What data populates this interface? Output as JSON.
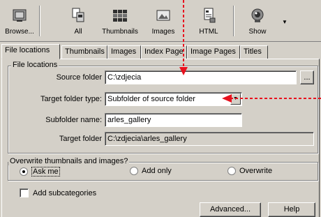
{
  "toolbar": {
    "buttons": [
      {
        "label": "Browse...",
        "icon": "browse-icon"
      },
      {
        "label": "All",
        "icon": "all-icon"
      },
      {
        "label": "Thumbnails",
        "icon": "thumbnails-icon"
      },
      {
        "label": "Images",
        "icon": "images-icon"
      },
      {
        "label": "HTML",
        "icon": "html-icon"
      },
      {
        "label": "Show",
        "icon": "show-icon"
      }
    ],
    "dropdown_icon": "dropdown-arrow-icon"
  },
  "tabs": [
    "File locations",
    "Thumbnails",
    "Images",
    "Index Page",
    "Image Pages",
    "Titles"
  ],
  "active_tab": "File locations",
  "file_locations": {
    "group_title": "File locations",
    "source_folder_label": "Source folder",
    "source_folder_value": "C:\\zdjecia",
    "browse_button": "...",
    "target_type_label": "Target folder type:",
    "target_type_value": "Subfolder of source folder",
    "subfolder_label": "Subfolder name:",
    "subfolder_value": "arles_gallery",
    "target_folder_label": "Target folder",
    "target_folder_value": "C:\\zdjecia\\arles_gallery"
  },
  "overwrite": {
    "group_title": "Overwrite thumbnails and images?",
    "options": [
      "Ask me",
      "Add only",
      "Overwrite"
    ],
    "selected": "Ask me"
  },
  "subcategories_label": "Add subcategories",
  "subcategories_checked": false,
  "buttons": {
    "advanced": "Advanced...",
    "help": "Help"
  },
  "annotation_color": "#e8111e"
}
